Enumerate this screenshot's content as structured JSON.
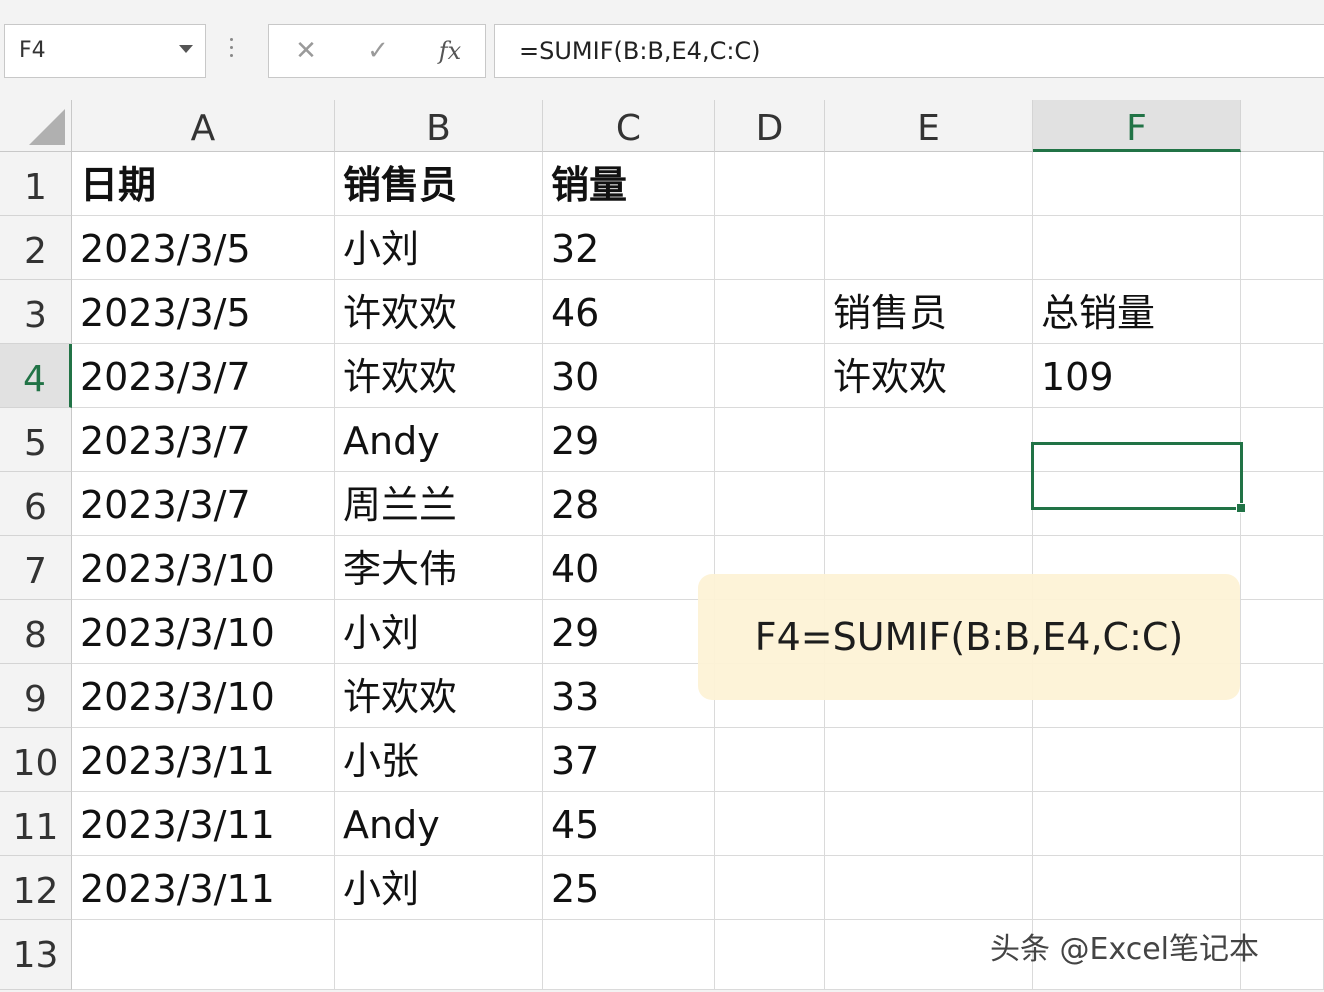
{
  "formula_bar": {
    "name_box": "F4",
    "cancel_symbol": "✕",
    "enter_symbol": "✓",
    "fx_label": "fx",
    "formula": "=SUMIF(B:B,E4,C:C)"
  },
  "columns": [
    "A",
    "B",
    "C",
    "D",
    "E",
    "F"
  ],
  "rows": [
    "1",
    "2",
    "3",
    "4",
    "5",
    "6",
    "7",
    "8",
    "9",
    "10",
    "11",
    "12",
    "13"
  ],
  "cells": {
    "A1": "日期",
    "B1": "销售员",
    "C1": "销量",
    "A2": "2023/3/5",
    "B2": "小刘",
    "C2": "32",
    "A3": "2023/3/5",
    "B3": "许欢欢",
    "C3": "46",
    "E3": "销售员",
    "F3": "总销量",
    "A4": "2023/3/7",
    "B4": "许欢欢",
    "C4": "30",
    "E4": "许欢欢",
    "F4": "109",
    "A5": "2023/3/7",
    "B5": "Andy",
    "C5": "29",
    "A6": "2023/3/7",
    "B6": "周兰兰",
    "C6": "28",
    "A7": "2023/3/10",
    "B7": "李大伟",
    "C7": "40",
    "A8": "2023/3/10",
    "B8": "小刘",
    "C8": "29",
    "A9": "2023/3/10",
    "B9": "许欢欢",
    "C9": "33",
    "A10": "2023/3/11",
    "B10": "小张",
    "C10": "37",
    "A11": "2023/3/11",
    "B11": "Andy",
    "C11": "45",
    "A12": "2023/3/11",
    "B12": "小刘",
    "C12": "25"
  },
  "selected_cell": "F4",
  "annotation": "F4=SUMIF(B:B,E4,C:C)",
  "watermark": "头条 @Excel笔记本",
  "colors": {
    "accent": "#217346",
    "note_bg": "#fdf3d6"
  }
}
